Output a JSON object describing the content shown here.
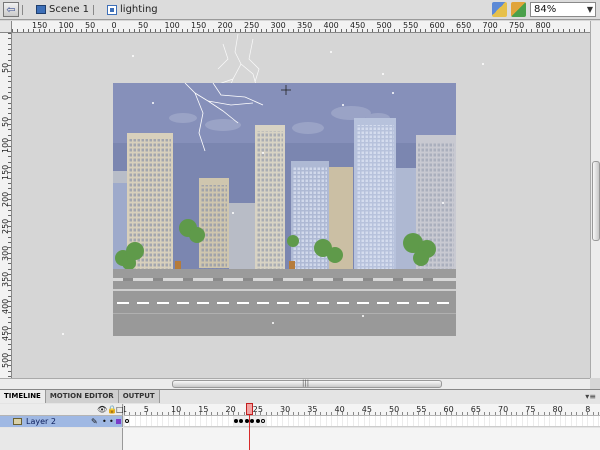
{
  "topbar": {
    "back_icon": "back-arrow-icon",
    "crumbs": [
      {
        "label": "Scene 1",
        "icon": "scene-icon"
      },
      {
        "label": "lighting",
        "icon": "movieclip-symbol-icon"
      }
    ],
    "zoom_value": "84%",
    "tool_icons": [
      "edit-symbols-icon",
      "edit-scene-icon"
    ]
  },
  "ruler": {
    "h_labels": [
      "150",
      "100",
      "50",
      "0",
      "50",
      "100",
      "150",
      "200",
      "250",
      "300",
      "350",
      "400",
      "450",
      "500",
      "550",
      "600",
      "650",
      "700",
      "750",
      "800"
    ],
    "v_labels": [
      "50",
      "0",
      "50",
      "100",
      "150",
      "200",
      "250",
      "300",
      "350",
      "400",
      "450",
      "500"
    ]
  },
  "timeline": {
    "tabs": [
      "TIMELINE",
      "MOTION EDITOR",
      "OUTPUT"
    ],
    "active_tab": "TIMELINE",
    "frame_numbers": [
      "1",
      "5",
      "10",
      "15",
      "20",
      "25",
      "30",
      "35",
      "40",
      "45",
      "50",
      "55",
      "60",
      "65",
      "70",
      "75",
      "80",
      "8"
    ],
    "layer_name": "Layer 2",
    "current_frame": 25,
    "keyframes": [
      1,
      21,
      22,
      23,
      24,
      25,
      26
    ]
  },
  "colors": {
    "sky": "#7b86b0",
    "road": "#9a9a9a",
    "playhead": "#d82b2b",
    "layer_selected": "#9fb8e3"
  }
}
